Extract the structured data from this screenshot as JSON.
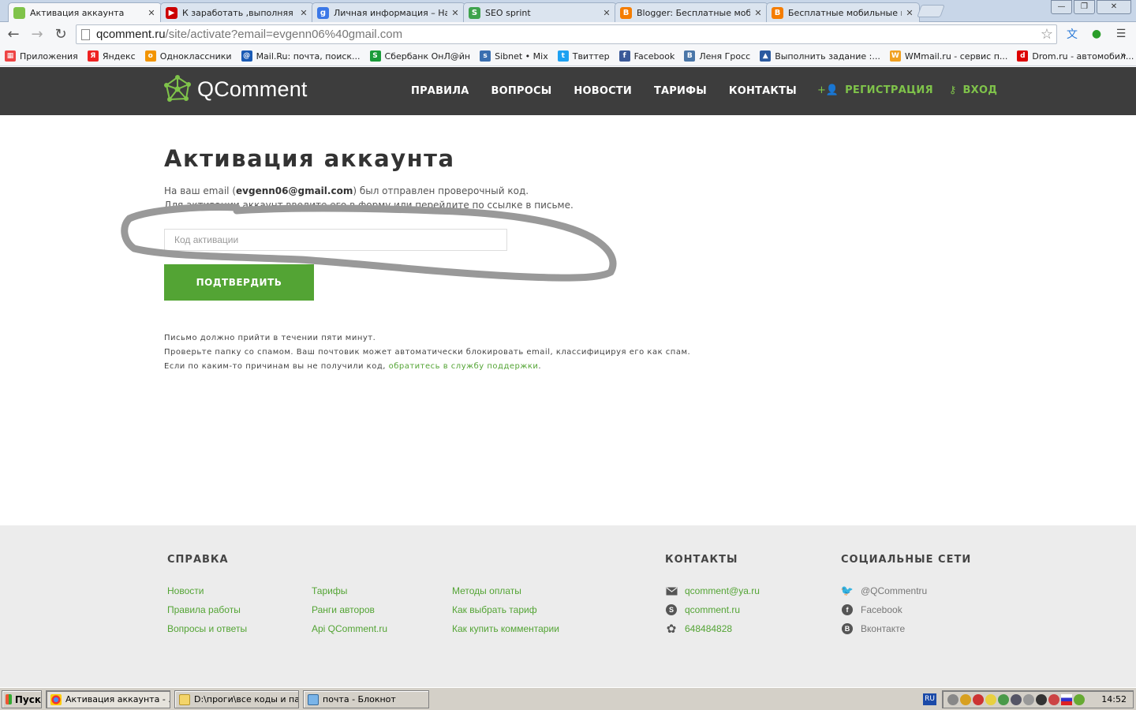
{
  "browser": {
    "tabs": [
      {
        "title": "Активация аккаунта",
        "active": true,
        "favicon": "qcomment-favicon",
        "color": "#7fc34a"
      },
      {
        "title": "К заработать ,выполняя за",
        "active": false,
        "favicon": "youtube-favicon",
        "color": "#cc0000"
      },
      {
        "title": "Личная информация – Наст",
        "active": false,
        "favicon": "google-favicon",
        "color": "#3b78e7"
      },
      {
        "title": "SEO sprint",
        "active": false,
        "favicon": "seosprint-favicon",
        "color": "#3fa34d"
      },
      {
        "title": "Blogger: Бесплатные мобил",
        "active": false,
        "favicon": "blogger-favicon",
        "color": "#f57d00"
      },
      {
        "title": "Бесплатные мобильные при",
        "active": false,
        "favicon": "blogger-favicon",
        "color": "#f57d00"
      }
    ],
    "url_host": "qcomment.ru",
    "url_path": "/site/activate?email=evgenn06%40gmail.com",
    "bookmarks": [
      {
        "label": "Приложения",
        "icon": "apps-icon",
        "color": "#e44"
      },
      {
        "label": "Яндекс",
        "icon": "yandex-icon",
        "color": "#e22"
      },
      {
        "label": "Одноклассники",
        "icon": "odnoklassniki-icon",
        "color": "#f29400"
      },
      {
        "label": "Mail.Ru: почта, поиск...",
        "icon": "mailru-icon",
        "color": "#1a5bb5"
      },
      {
        "label": "Сбербанк ОнЛ@йн",
        "icon": "sberbank-icon",
        "color": "#1a9b3a"
      },
      {
        "label": "Sibnet • Mix",
        "icon": "sibnet-icon",
        "color": "#3a6fb0"
      },
      {
        "label": "Твиттер",
        "icon": "twitter-icon",
        "color": "#1da1f2"
      },
      {
        "label": "Facebook",
        "icon": "facebook-icon",
        "color": "#3b5998"
      },
      {
        "label": "Леня Гросс",
        "icon": "vk-icon",
        "color": "#4a76a8"
      },
      {
        "label": "Выполнить задание :...",
        "icon": "task-icon",
        "color": "#2b5aa0"
      },
      {
        "label": "WMmail.ru - сервис п...",
        "icon": "wmmail-icon",
        "color": "#f0a020"
      },
      {
        "label": "Drom.ru - автомобил...",
        "icon": "drom-icon",
        "color": "#d00"
      }
    ]
  },
  "site": {
    "logo_text": "QComment",
    "nav": [
      "ПРАВИЛА",
      "ВОПРОСЫ",
      "НОВОСТИ",
      "ТАРИФЫ",
      "КОНТАКТЫ"
    ],
    "register_label": "РЕГИСТРАЦИЯ",
    "login_label": "ВХОД",
    "accent": "#7fc34a",
    "button_green": "#53a434"
  },
  "main": {
    "title": "Активация аккаунта",
    "intro_before": "На ваш email (",
    "intro_email": "evgenn06@gmail.com",
    "intro_after": ") был отправлен проверочный код.",
    "intro_line2": "Для активации аккаунт введите его в форму или перейдите по ссылке в письме.",
    "code_placeholder": "Код активации",
    "confirm_label": "ПОДТВЕРДИТЬ",
    "note1": "Письмо должно прийти в течении пяти минут.",
    "note2": "Проверьте папку со спамом. Ваш почтовик может автоматически блокировать email, классифицируя его как спам.",
    "note3_before": "Если по каким-то причинам вы не получили код, ",
    "note3_link": "обратитесь в службу поддержки",
    "note3_after": "."
  },
  "footer": {
    "help_heading": "СПРАВКА",
    "col1": [
      "Новости",
      "Правила работы",
      "Вопросы и ответы"
    ],
    "col2": [
      "Тарифы",
      "Ранги авторов",
      "Api QComment.ru"
    ],
    "col3": [
      "Методы оплаты",
      "Как выбрать тариф",
      "Как купить комментарии"
    ],
    "contacts_heading": "КОНТАКТЫ",
    "contacts": [
      {
        "icon": "envelope-icon",
        "text": "qcomment@ya.ru"
      },
      {
        "icon": "skype-icon",
        "text": "qcomment.ru"
      },
      {
        "icon": "icq-icon",
        "text": "648484828"
      }
    ],
    "social_heading": "СОЦИАЛЬНЫЕ СЕТИ",
    "social": [
      {
        "icon": "twitter-icon",
        "text": "@QCommentru"
      },
      {
        "icon": "facebook-icon",
        "text": "Facebook"
      },
      {
        "icon": "vkontakte-icon",
        "text": "Вконтакте"
      }
    ]
  },
  "taskbar": {
    "start_label": "Пуск",
    "tasks": [
      {
        "label": "Активация аккаунта - ...",
        "active": true
      },
      {
        "label": "D:\\проги\\все коды и па...",
        "active": false
      },
      {
        "label": "почта - Блокнот",
        "active": false
      }
    ],
    "lang": "RU",
    "clock": "14:52"
  }
}
